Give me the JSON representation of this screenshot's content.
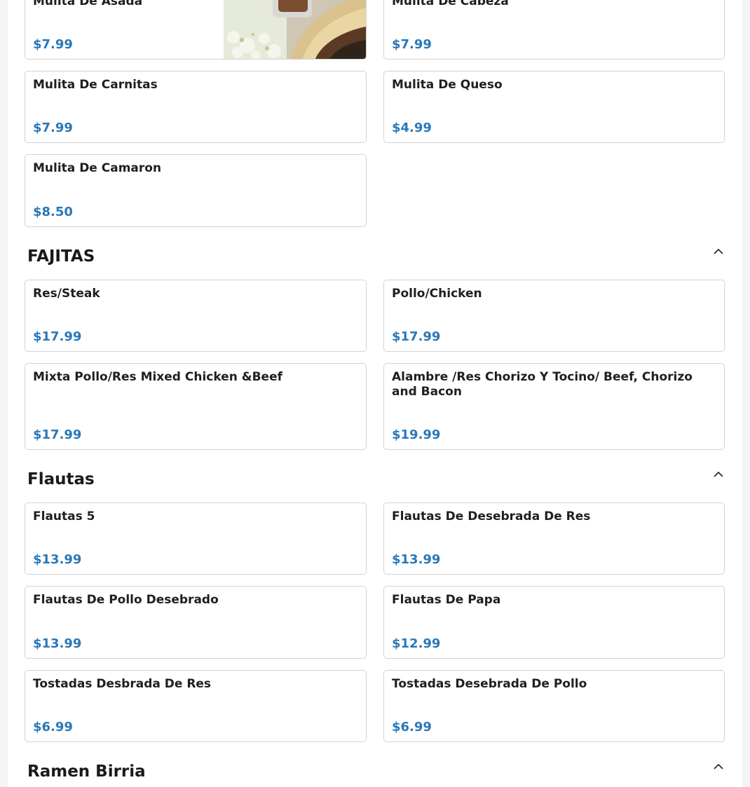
{
  "mulitas": {
    "items": [
      {
        "name": "Mulita De Asada",
        "price": "$7.99",
        "image": "food-photo"
      },
      {
        "name": "Mulita De Cabeza",
        "price": "$7.99"
      },
      {
        "name": "Mulita De Carnitas",
        "price": "$7.99"
      },
      {
        "name": "Mulita De Queso",
        "price": "$4.99"
      },
      {
        "name": "Mulita De Camaron",
        "price": "$8.50"
      }
    ]
  },
  "fajitas": {
    "title": "FAJITAS",
    "icon": "chevron-up-icon",
    "items": [
      {
        "name": "Res/Steak",
        "price": "$17.99"
      },
      {
        "name": "Pollo/Chicken",
        "price": "$17.99"
      },
      {
        "name": "Mixta Pollo/Res Mixed Chicken &Beef",
        "price": "$17.99"
      },
      {
        "name": "Alambre /Res Chorizo Y Tocino/ Beef, Chorizo and Bacon",
        "price": "$19.99"
      }
    ]
  },
  "flautas": {
    "title": "Flautas",
    "icon": "chevron-up-icon",
    "items": [
      {
        "name": "Flautas 5",
        "price": "$13.99"
      },
      {
        "name": "Flautas De Desebrada De Res",
        "price": "$13.99"
      },
      {
        "name": "Flautas De Pollo Desebrado",
        "price": "$13.99"
      },
      {
        "name": "Flautas De Papa",
        "price": "$12.99"
      },
      {
        "name": "Tostadas Desbrada De Res",
        "price": "$6.99"
      },
      {
        "name": "Tostadas Desebrada De Pollo",
        "price": "$6.99"
      }
    ]
  },
  "ramen": {
    "title": "Ramen Birria",
    "icon": "chevron-up-icon"
  },
  "colors": {
    "price": "#2a78b8",
    "border": "#d3d3d3",
    "background": "#f4f4f5"
  }
}
